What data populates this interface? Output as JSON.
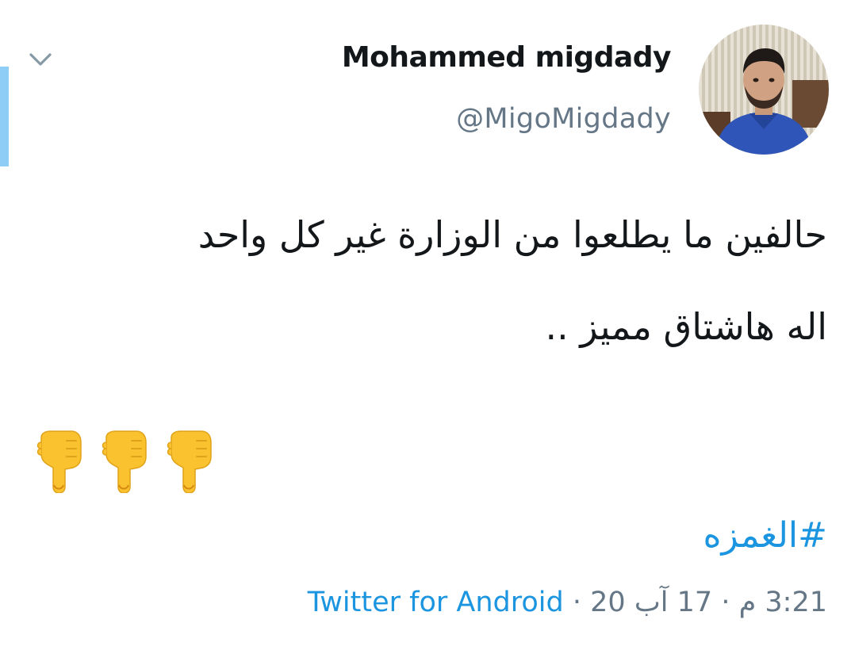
{
  "tweet": {
    "display_name": "Mohammed migdady",
    "handle": "@MigoMigdady",
    "text_lines": [
      "حالفين ما يطلعوا من الوزارة غير كل واحد",
      "اله هاشتاق مميز .."
    ],
    "emoji": [
      "backhand-index-pointing-down",
      "backhand-index-pointing-down",
      "backhand-index-pointing-down"
    ],
    "hashtag": "#الغمزه",
    "time": "3:21 م",
    "separator": "·",
    "date": "17 آب 20",
    "source": "Twitter for Android"
  },
  "colors": {
    "accent_bar": "#8ecdf5",
    "link": "#1b95e0",
    "secondary_text": "#657786",
    "primary_text": "#14171a"
  },
  "icons": {
    "collapse": "chevron-down-icon",
    "pointing_hand": "backhand-index-pointing-down-emoji"
  }
}
